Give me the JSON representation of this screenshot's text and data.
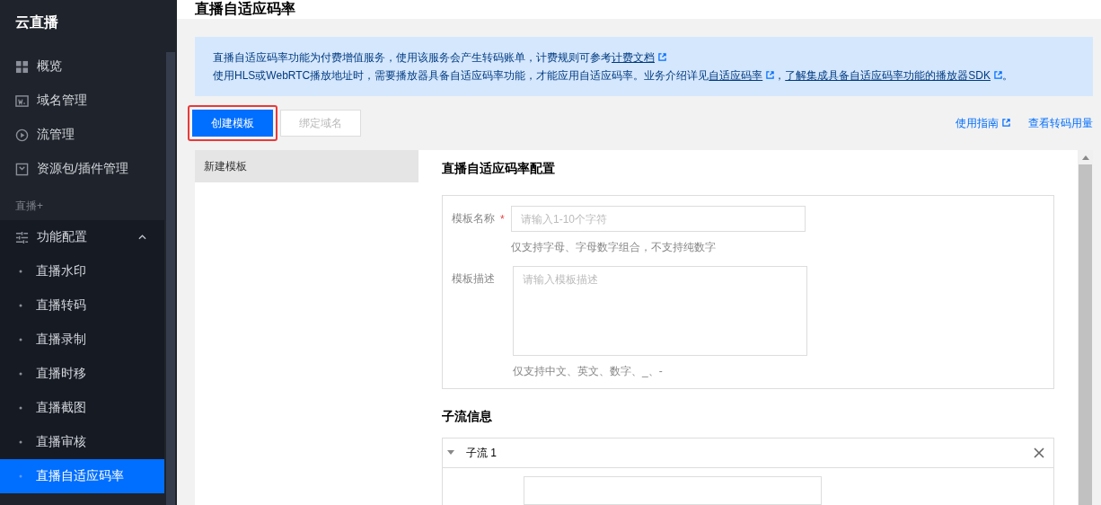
{
  "sidebar": {
    "title": "云直播",
    "items": [
      {
        "label": "概览",
        "selected": false
      },
      {
        "label": "域名管理",
        "selected": false
      },
      {
        "label": "流管理",
        "selected": false
      },
      {
        "label": "资源包/插件管理",
        "selected": false
      }
    ],
    "group_label": "直播+",
    "group": {
      "label": "功能配置",
      "expanded": true,
      "children": [
        {
          "label": "直播水印",
          "selected": false
        },
        {
          "label": "直播转码",
          "selected": false
        },
        {
          "label": "直播录制",
          "selected": false
        },
        {
          "label": "直播时移",
          "selected": false
        },
        {
          "label": "直播截图",
          "selected": false
        },
        {
          "label": "直播审核",
          "selected": false
        },
        {
          "label": "直播自适应码率",
          "selected": true
        }
      ]
    }
  },
  "header": {
    "title": "直播自适应码率"
  },
  "notice": {
    "lines": [
      [
        {
          "text": "直播自适应码率功能为付费增值服务，使用该服务会产生转码账单，计费规则可参考"
        },
        {
          "text": "计费文档",
          "link": true
        }
      ],
      [
        {
          "text": "使用HLS或WebRTC播放地址时，需要播放器具备自适应码率功能，才能应用自适应码率。业务介绍详见"
        },
        {
          "text": "自适应码率",
          "link": true
        },
        {
          "text": "，"
        },
        {
          "text": "了解集成具备自适应码率功能的播放器SDK",
          "link": true
        },
        {
          "text": "。"
        }
      ]
    ]
  },
  "toolbar": {
    "buttons": [
      {
        "label": "创建模板",
        "disabled": false,
        "highlighted": true
      },
      {
        "label": "绑定域名",
        "disabled": true,
        "highlighted": false
      }
    ],
    "links": [
      {
        "label": "使用指南",
        "external": true
      },
      {
        "label": "查看转码用量",
        "external": false
      }
    ]
  },
  "template_list": [
    {
      "label": "新建模板",
      "selected": true
    }
  ],
  "config": {
    "title": "直播自适应码率配置",
    "fields": [
      {
        "kind": "input",
        "label": "模板名称",
        "required_mark": "*",
        "placeholder": "请输入1-10个字符",
        "hint": "仅支持字母、字母数字组合，不支持纯数字"
      },
      {
        "kind": "textarea",
        "label": "模板描述",
        "placeholder": "请输入模板描述",
        "hint": "仅支持中文、英文、数字、_、-"
      }
    ],
    "substreams_title": "子流信息",
    "substreams": [
      {
        "label": "子流 1",
        "expanded": true
      }
    ]
  }
}
